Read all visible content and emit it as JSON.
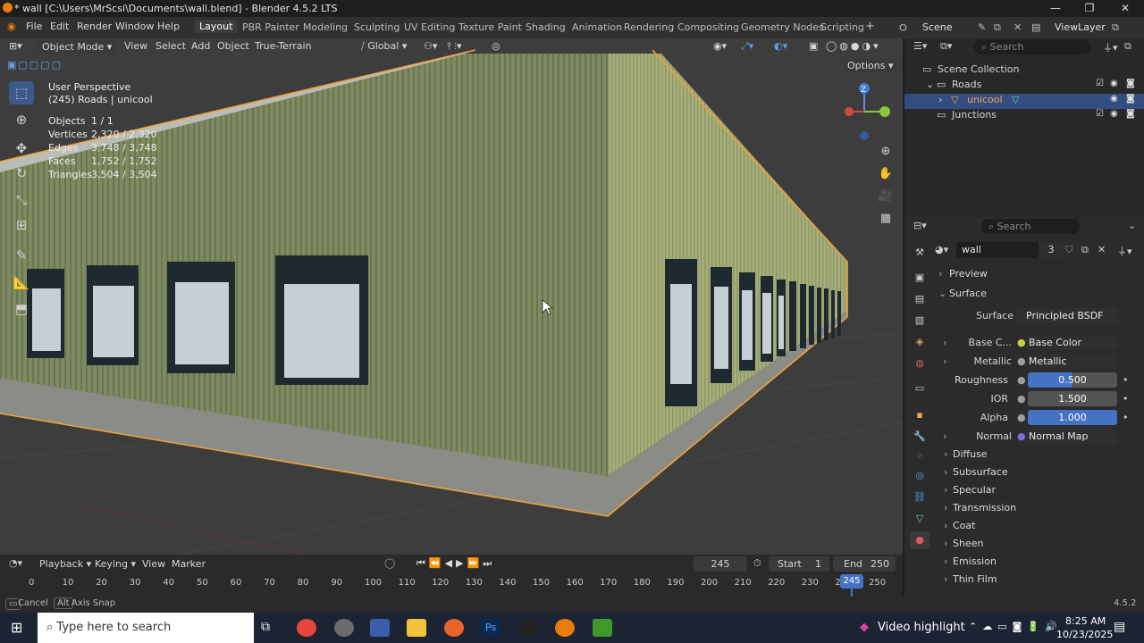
{
  "window": {
    "title": "* wall [C:\\Users\\MrScsi\\Documents\\wall.blend] - Blender 4.5.2 LTS",
    "minimize": "—",
    "maximize": "❐",
    "close": "✕"
  },
  "menu": [
    "File",
    "Edit",
    "Render",
    "Window",
    "Help"
  ],
  "workspaces": [
    "Layout",
    "PBR Painter",
    "Modeling",
    "Sculpting",
    "UV Editing",
    "Texture Paint",
    "Shading",
    "Animation",
    "Rendering",
    "Compositing",
    "Geometry Nodes",
    "Scripting"
  ],
  "scene": "Scene",
  "view_layer": "ViewLayer",
  "viewport_header": {
    "mode": "Object Mode",
    "view": "View",
    "select": "Select",
    "add": "Add",
    "object": "Object",
    "addon": "True-Terrain",
    "orientation": "Global",
    "options": "Options"
  },
  "overlay": {
    "perspective": "User Perspective",
    "context": "(245) Roads | unicool",
    "stats": [
      {
        "label": "Objects",
        "value": "1 / 1"
      },
      {
        "label": "Vertices",
        "value": "2,320 / 2,320"
      },
      {
        "label": "Edges",
        "value": "3,748 / 3,748"
      },
      {
        "label": "Faces",
        "value": "1,752 / 1,752"
      },
      {
        "label": "Triangles",
        "value": "3,504 / 3,504"
      }
    ]
  },
  "gizmo": {
    "z": "Z"
  },
  "outliner": {
    "search": "Search",
    "root": "Scene Collection",
    "items": [
      "Roads",
      "unicool",
      "Junctions"
    ]
  },
  "properties": {
    "search": "Search",
    "material": "wall",
    "users": "3",
    "sections": {
      "preview": "Preview",
      "surface": "Surface"
    },
    "surface_label": "Surface",
    "surface_value": "Principled BSDF",
    "inputs": [
      {
        "label": "Base C...",
        "value": "Base Color",
        "color": "#c8d23c"
      },
      {
        "label": "Metallic",
        "value": "Metallic",
        "color": "#9e9e9e"
      },
      {
        "label": "Roughness",
        "value": "0.500",
        "fill": 0.5
      },
      {
        "label": "IOR",
        "value": "1.500",
        "fill": 0
      },
      {
        "label": "Alpha",
        "value": "1.000",
        "fill": 1
      },
      {
        "label": "Normal",
        "value": "Normal Map",
        "color": "#7a6de0"
      }
    ],
    "subsections": [
      "Diffuse",
      "Subsurface",
      "Specular",
      "Transmission",
      "Coat",
      "Sheen",
      "Emission",
      "Thin Film"
    ]
  },
  "timeline": {
    "menus": [
      "Playback",
      "Keying",
      "View",
      "Marker"
    ],
    "current": "245",
    "start_label": "Start",
    "start": "1",
    "end_label": "End",
    "end": "250",
    "ticks": [
      "0",
      "10",
      "20",
      "30",
      "40",
      "50",
      "60",
      "70",
      "80",
      "90",
      "100",
      "110",
      "120",
      "130",
      "140",
      "150",
      "160",
      "170",
      "180",
      "190",
      "200",
      "210",
      "220",
      "230",
      "240",
      "250"
    ]
  },
  "status": {
    "cancel": "Cancel",
    "alt": "Alt",
    "axis_snap": "Axis Snap",
    "version": "4.5.2"
  },
  "taskbar": {
    "search": "Type here to search",
    "video": "Video highlight",
    "time": "8:25 AM",
    "date": "10/23/2025"
  }
}
